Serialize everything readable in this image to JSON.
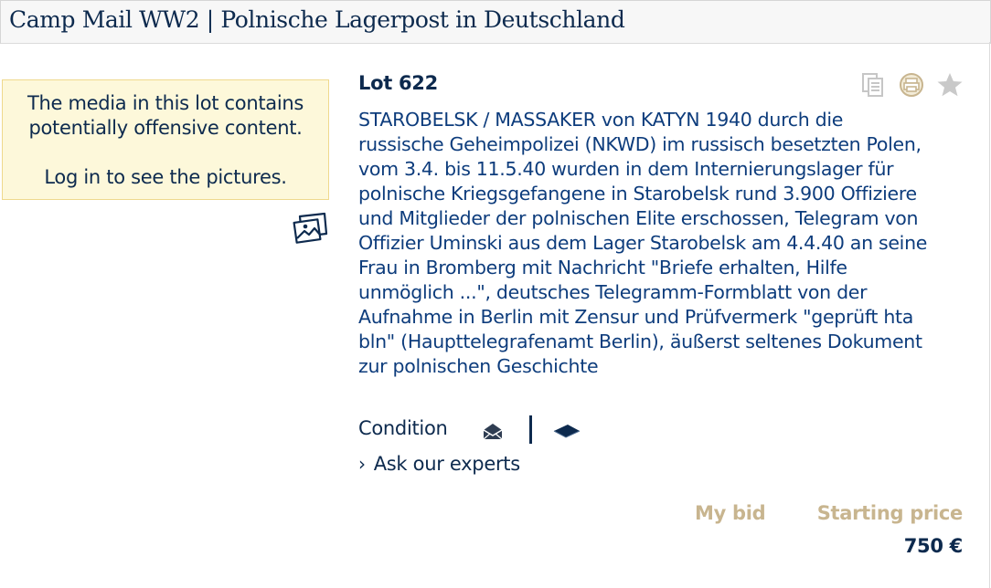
{
  "header": {
    "title": "Camp Mail WW2 | Polnische Lagerpost in Deutschland"
  },
  "notice": {
    "line1": "The media in this lot contains potentially offensive content.",
    "line2": "Log in to see the pictures.",
    "icon": "gallery-icon"
  },
  "lot": {
    "title": "Lot 622",
    "actions": [
      "copy-icon",
      "print-icon",
      "watchlist-star-icon"
    ],
    "description": "STAROBELSK / MASSAKER von KATYN 1940 durch die russische Geheimpolizei (NKWD) im russisch besetzten Polen, vom 3.4. bis 11.5.40 wurden in dem Internierungslager für polnische Kriegsgefangene in Starobelsk rund 3.900 Offiziere und Mitglieder der polnischen Elite erschossen, Telegram von Offizier Uminski aus dem Lager Starobelsk am 4.4.40 an seine Frau in Bromberg mit Nachricht \"Briefe erhalten, Hilfe unmöglich ...\", deutsches Telegramm-Formblatt von der Aufnahme in Berlin mit Zensur und Prüfvermerk \"geprüft hta bln\" (Haupttelegrafenamt Berlin), äußerst seltenes Dokument zur polnischen Geschichte",
    "condition_label": "Condition",
    "condition_icons": [
      "envelope-icon",
      "card-icon"
    ],
    "ask_label": "Ask our experts",
    "my_bid_label": "My bid",
    "starting_price_label": "Starting price",
    "starting_price_value": "750 €"
  },
  "colors": {
    "navy": "#0d2a4e",
    "link_blue": "#0d3c7c",
    "gold": "#c8b58f",
    "notice_bg": "#fdf8da",
    "notice_border": "#efd98d"
  }
}
